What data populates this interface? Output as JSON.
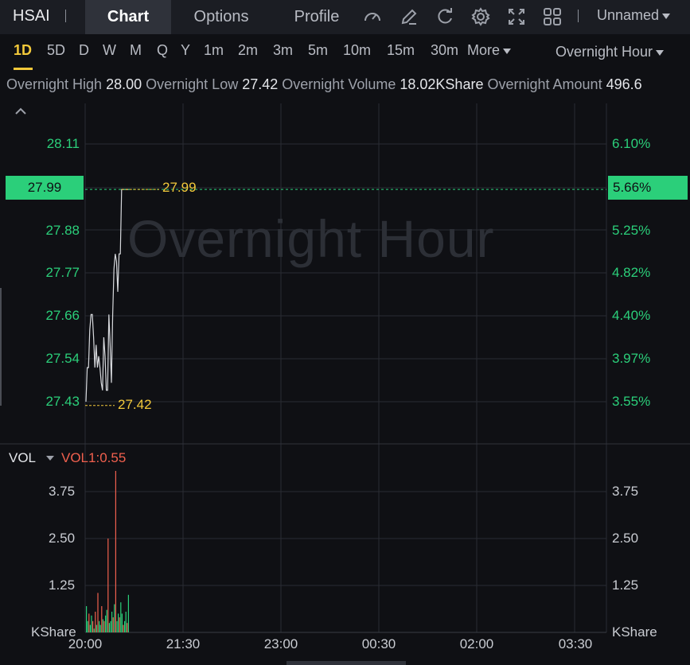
{
  "symbol": "HSAI",
  "tabs": [
    {
      "label": "Chart",
      "active": true
    },
    {
      "label": "Options",
      "active": false
    },
    {
      "label": "Profile",
      "active": false
    }
  ],
  "toolbar_icons": [
    "gauge-icon",
    "pen-icon",
    "refresh-icon",
    "gear-icon",
    "expand-icon",
    "grid-icon"
  ],
  "layout_name": "Unnamed",
  "periods": [
    {
      "label": "1D",
      "active": true
    },
    {
      "label": "5D"
    },
    {
      "label": "D"
    },
    {
      "label": "W"
    },
    {
      "label": "M"
    },
    {
      "label": "Q"
    },
    {
      "label": "Y"
    },
    {
      "label": "1m"
    },
    {
      "label": "2m"
    },
    {
      "label": "3m"
    },
    {
      "label": "5m"
    },
    {
      "label": "10m"
    },
    {
      "label": "15m"
    },
    {
      "label": "30m"
    }
  ],
  "more_label": "More",
  "session_label": "Overnight Hour",
  "stats": {
    "high_label": "Overnight High",
    "high": "28.00",
    "low_label": "Overnight Low",
    "low": "27.42",
    "volume_label": "Overnight Volume",
    "volume": "18.02KShare",
    "amount_label": "Overnight Amount",
    "amount": "496.6"
  },
  "watermark": "Overnight Hour",
  "colors": {
    "up": "#2bcf7a",
    "down": "#f0604e",
    "accent": "#f3c93a"
  },
  "chart_data": [
    {
      "type": "line",
      "price_axis": [
        "28.11",
        "27.99",
        "27.88",
        "27.77",
        "27.66",
        "27.54",
        "27.43"
      ],
      "percent_axis": [
        "6.10%",
        "5.66%",
        "5.25%",
        "4.82%",
        "4.40%",
        "3.97%",
        "3.55%"
      ],
      "current_price": "27.99",
      "current_percent": "5.66%",
      "high_marker": "27.99",
      "low_marker": "27.42",
      "ylim": [
        27.43,
        28.11
      ],
      "x_ticks": [
        "20:00",
        "21:30",
        "23:00",
        "00:30",
        "02:00",
        "03:30"
      ],
      "series": [
        {
          "x": [
            0,
            1,
            2,
            3,
            4,
            5,
            6,
            7,
            8,
            9,
            10,
            11,
            12,
            13,
            14,
            15,
            16,
            17,
            18,
            19,
            20,
            21,
            22,
            23,
            24,
            25,
            26,
            27,
            28,
            29,
            30,
            31,
            32,
            33,
            34
          ],
          "values": [
            27.43,
            27.52,
            27.52,
            27.62,
            27.66,
            27.66,
            27.6,
            27.52,
            27.58,
            27.52,
            27.55,
            27.52,
            27.48,
            27.46,
            27.6,
            27.55,
            27.46,
            27.46,
            27.66,
            27.58,
            27.48,
            27.66,
            27.78,
            27.82,
            27.8,
            27.72,
            27.82,
            27.82,
            27.99,
            27.99,
            27.99,
            27.99,
            27.99,
            27.99,
            27.99
          ]
        }
      ]
    },
    {
      "type": "bar",
      "indicator_name": "VOL",
      "indicator_value": "VOL1:0.55",
      "axis": [
        "3.75",
        "2.50",
        "1.25"
      ],
      "unit": "KShare",
      "ylim": [
        0,
        4.3
      ],
      "values": [
        0.7,
        0.3,
        0.5,
        0.2,
        0.45,
        0.3,
        0.1,
        0.55,
        0.2,
        1.05,
        0.3,
        0.2,
        0.7,
        0.35,
        0.3,
        0.45,
        0.6,
        2.5,
        0.25,
        0.3,
        0.55,
        0.4,
        0.75,
        4.3,
        0.3,
        0.5,
        0.4,
        0.8,
        0.5,
        0.2,
        0.3,
        0.55,
        0.25,
        1.0
      ],
      "up": [
        true,
        true,
        false,
        true,
        true,
        false,
        true,
        false,
        true,
        false,
        true,
        true,
        false,
        true,
        false,
        true,
        true,
        false,
        true,
        true,
        true,
        false,
        true,
        false,
        true,
        true,
        false,
        true,
        true,
        false,
        true,
        true,
        false,
        true
      ]
    }
  ]
}
